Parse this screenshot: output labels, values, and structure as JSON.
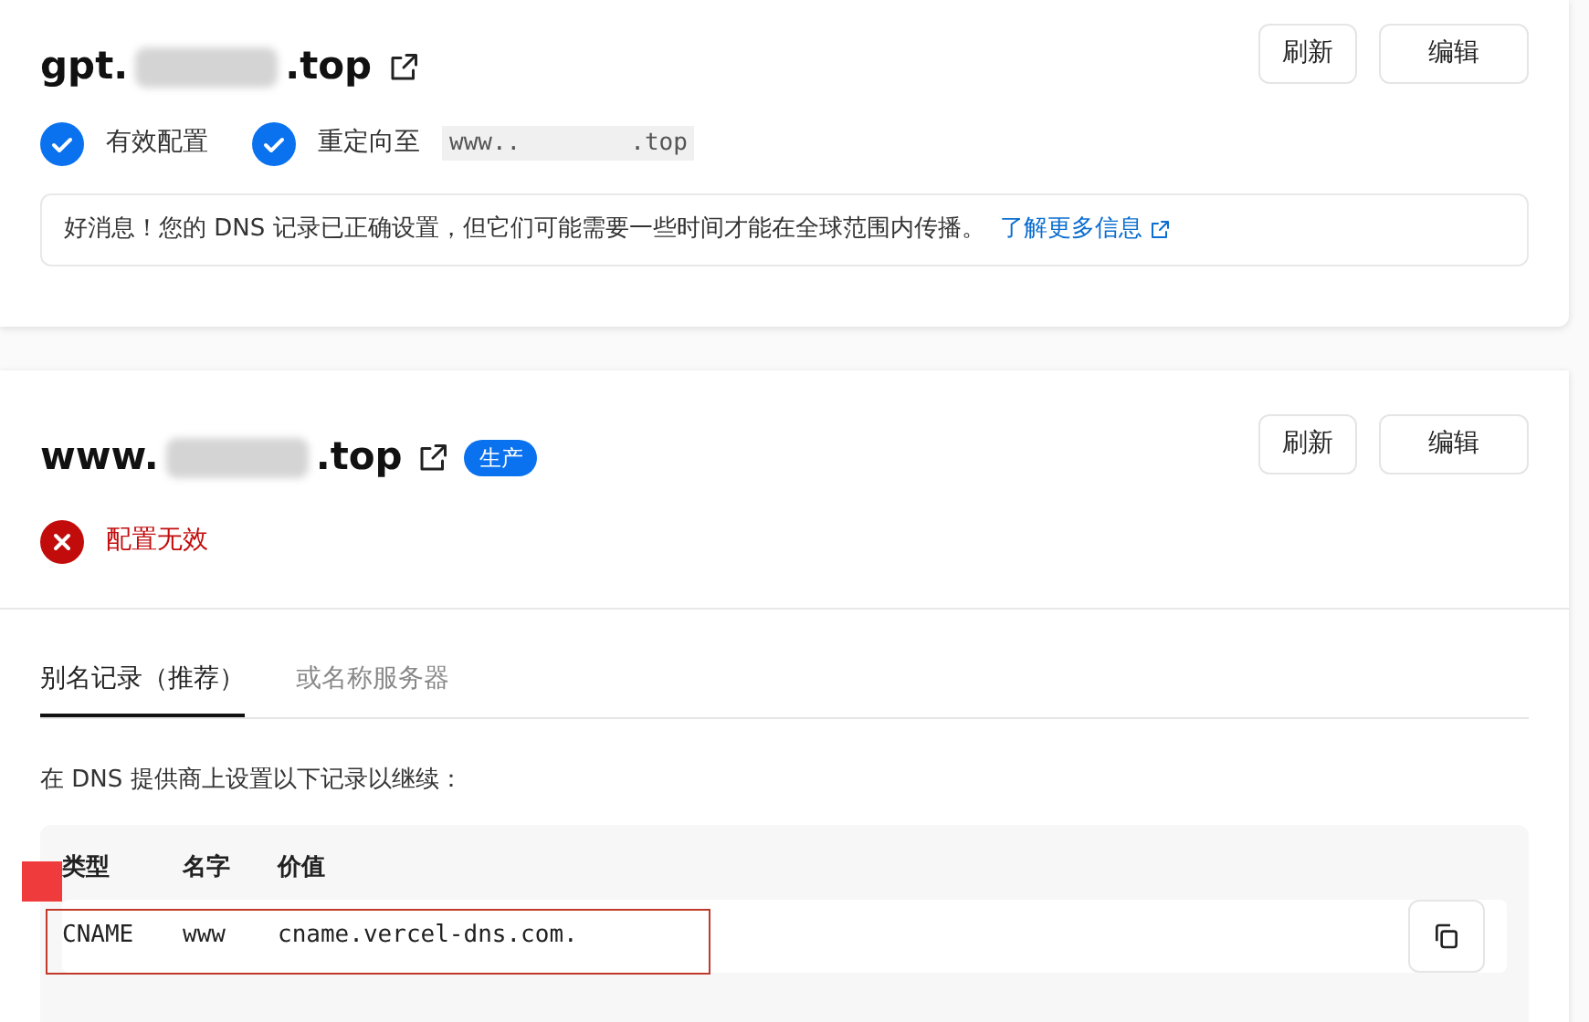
{
  "domains": [
    {
      "prefix": "gpt.",
      "suffix": ".top",
      "buttons": [
        "刷新",
        "编辑"
      ],
      "statuses": [
        {
          "kind": "valid",
          "label": "有效配置"
        },
        {
          "kind": "redirect",
          "label": "重定向至",
          "code_prefix": "www..",
          "code_suffix": ".top"
        }
      ],
      "notice": {
        "text": "好消息！您的 DNS 记录已正确设置，但它们可能需要一些时间才能在全球范围内传播。",
        "link": "了解更多信息"
      }
    },
    {
      "prefix": "www.",
      "suffix": ".top",
      "badge": "生产",
      "buttons": [
        "刷新",
        "编辑"
      ],
      "statuses": [
        {
          "kind": "invalid",
          "label": "配置无效"
        }
      ],
      "tabs": [
        {
          "label": "别名记录（推荐）",
          "selected": true
        },
        {
          "label": "或名称服务器",
          "selected": false
        }
      ],
      "instructions": "在 DNS 提供商上设置以下记录以继续：",
      "records": {
        "columns": [
          "类型",
          "名字",
          "价值"
        ],
        "rows": [
          [
            "CNAME",
            "www",
            "cname.vercel-dns.com."
          ]
        ]
      }
    }
  ]
}
